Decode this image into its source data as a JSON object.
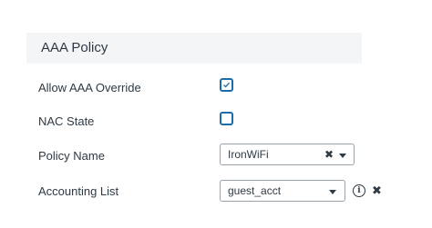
{
  "section": {
    "title": "AAA Policy"
  },
  "fields": {
    "allow_aaa_override": {
      "label": "Allow AAA Override",
      "checked": true
    },
    "nac_state": {
      "label": "NAC State",
      "checked": false
    },
    "policy_name": {
      "label": "Policy Name",
      "value": "IronWiFi",
      "clear_icon": "close-icon",
      "dropdown_icon": "chevron-down-icon"
    },
    "accounting_list": {
      "label": "Accounting List",
      "value": "guest_acct",
      "dropdown_icon": "chevron-down-icon",
      "info_glyph": "i",
      "remove_icon": "close-icon"
    }
  },
  "colors": {
    "checkbox_accent": "#1b6ca8",
    "header_background": "#f4f5f6",
    "text": "#2e3a44",
    "field_border": "#9aa3ab"
  },
  "glyphs": {
    "x": "✖"
  }
}
